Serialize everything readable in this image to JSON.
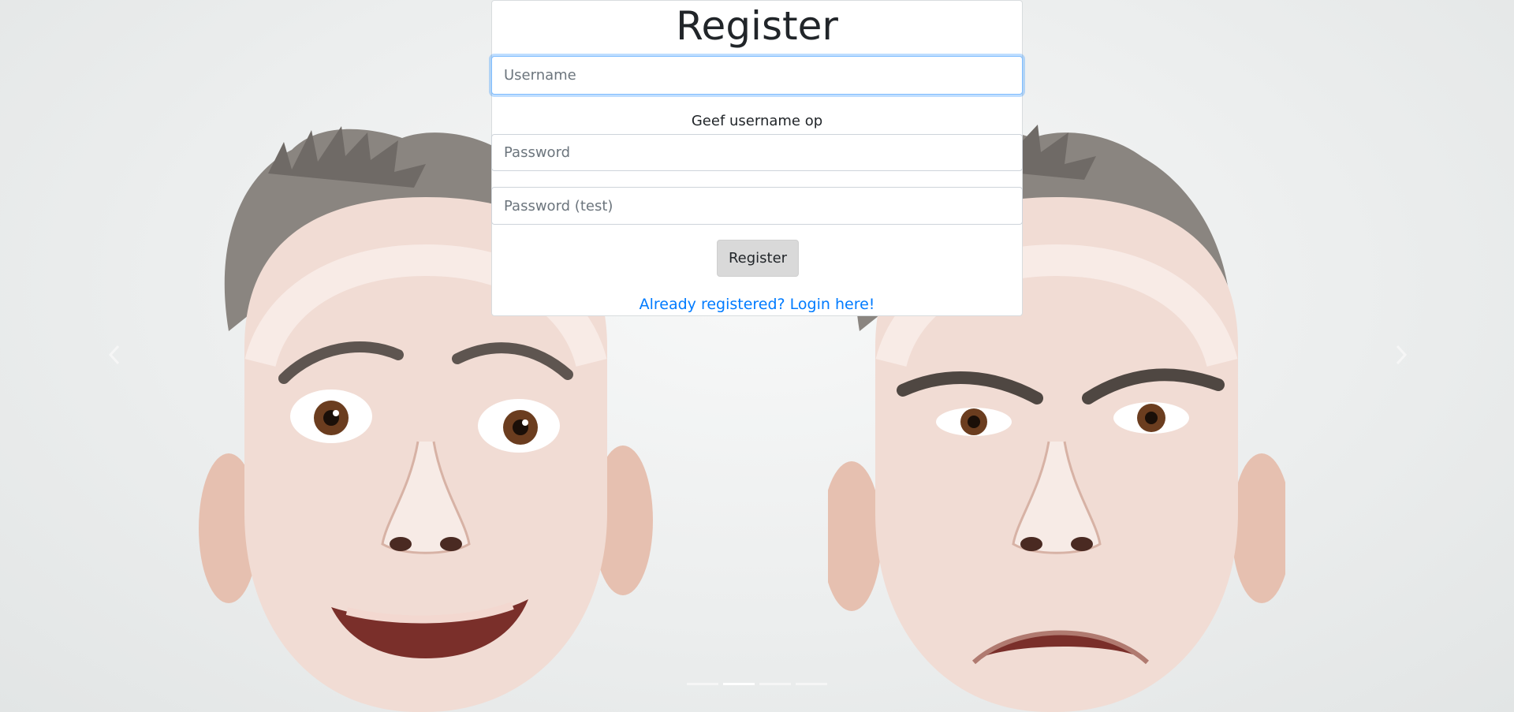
{
  "form": {
    "title": "Register",
    "username_placeholder": "Username",
    "username_value": "",
    "username_hint": "Geef username op",
    "password_placeholder": "Password",
    "password_value": "",
    "password_test_placeholder": "Password (test)",
    "password_test_value": "",
    "submit_label": "Register",
    "login_link_label": "Already registered? Login here!"
  },
  "carousel": {
    "prev_icon": "chevron-left-icon",
    "next_icon": "chevron-right-icon",
    "indicator_count": 4,
    "active_indicator": 1
  },
  "colors": {
    "link": "#007bff",
    "button_bg": "#d9d9d9",
    "focus_border": "#80bdff"
  }
}
